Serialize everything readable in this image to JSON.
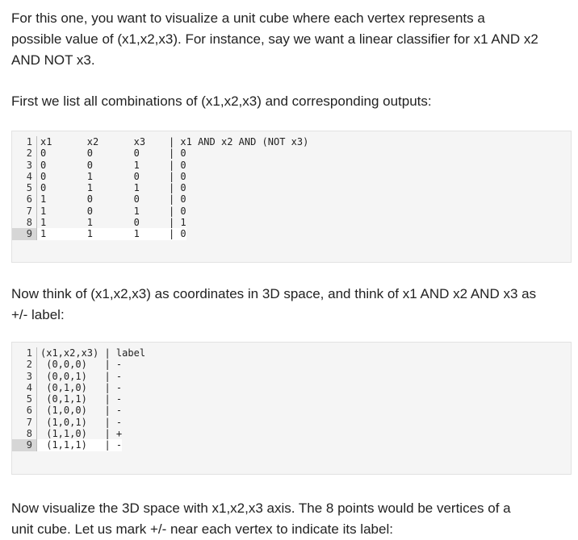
{
  "paragraphs": {
    "intro_line1": "For this one, you want to visualize a unit cube where each vertex represents a",
    "intro_line2": "possible value of (x1,x2,x3). For instance, say we want a linear classifier for x1 AND x2",
    "intro_line3": "AND NOT x3.",
    "list_line": "First we list all combinations of (x1,x2,x3) and corresponding outputs:",
    "think_line1": "Now think of (x1,x2,x3) as coordinates in 3D space, and think of x1 AND x2 AND x3 as",
    "think_line2": "+/- label:",
    "viz_line1": "Now visualize the 3D space with x1,x2,x3 axis. The 8 points would be vertices of a",
    "viz_line2": "unit cube. Let us mark +/- near each vertex to indicate its label:"
  },
  "code_block_1": {
    "lines": [
      {
        "num": "1",
        "text": "x1      x2      x3    | x1 AND x2 AND (NOT x3)"
      },
      {
        "num": "2",
        "text": "0       0       0     | 0"
      },
      {
        "num": "3",
        "text": "0       0       1     | 0"
      },
      {
        "num": "4",
        "text": "0       1       0     | 0"
      },
      {
        "num": "5",
        "text": "0       1       1     | 0"
      },
      {
        "num": "6",
        "text": "1       0       0     | 0"
      },
      {
        "num": "7",
        "text": "1       0       1     | 0"
      },
      {
        "num": "8",
        "text": "1       1       0     | 1"
      },
      {
        "num": "9",
        "text": "1       1       1     | 0"
      }
    ]
  },
  "code_block_2": {
    "lines": [
      {
        "num": "1",
        "text": "(x1,x2,x3) | label"
      },
      {
        "num": "2",
        "text": " (0,0,0)   | -"
      },
      {
        "num": "3",
        "text": " (0,0,1)   | -"
      },
      {
        "num": "4",
        "text": " (0,1,0)   | -"
      },
      {
        "num": "5",
        "text": " (0,1,1)   | -"
      },
      {
        "num": "6",
        "text": " (1,0,0)   | -"
      },
      {
        "num": "7",
        "text": " (1,0,1)   | -"
      },
      {
        "num": "8",
        "text": " (1,1,0)   | +"
      },
      {
        "num": "9",
        "text": " (1,1,1)   | -"
      }
    ]
  }
}
